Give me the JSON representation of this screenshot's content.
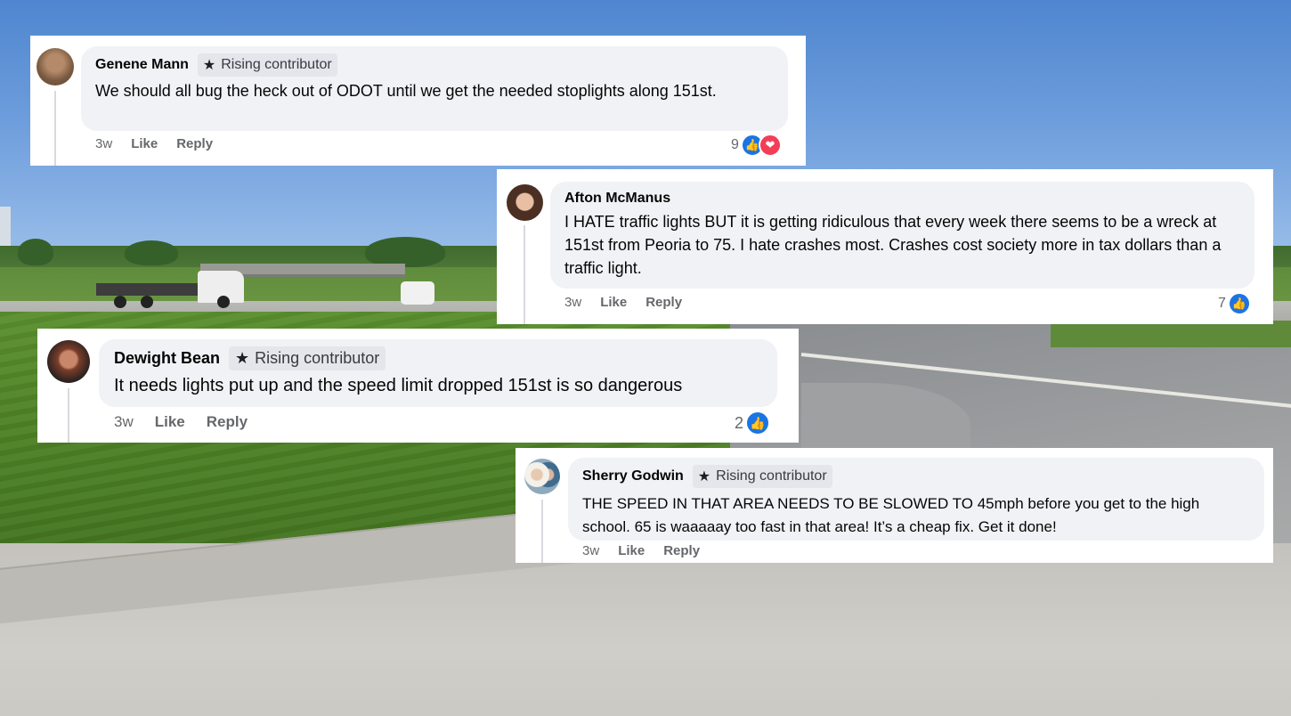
{
  "comments": [
    {
      "author": "Genene Mann",
      "badge": "Rising contributor",
      "text": "We should all bug the heck out of ODOT until we get the needed stoplights along 151st.",
      "time": "3w",
      "like_label": "Like",
      "reply_label": "Reply",
      "reaction_count": "9",
      "reactions": [
        "like-icon",
        "love-icon"
      ]
    },
    {
      "author": "Afton McManus",
      "badge": "",
      "text": "I HATE traffic lights BUT it is getting ridiculous that every week there seems to be a wreck at 151st from Peoria to 75. I hate crashes most. Crashes cost society more in tax dollars than a traffic light.",
      "time": "3w",
      "like_label": "Like",
      "reply_label": "Reply",
      "reaction_count": "7",
      "reactions": [
        "like-icon"
      ]
    },
    {
      "author": "Dewight Bean",
      "badge": "Rising contributor",
      "text": "It needs lights put up and the speed limit dropped 151st is so dangerous",
      "time": "3w",
      "like_label": "Like",
      "reply_label": "Reply",
      "reaction_count": "2",
      "reactions": [
        "like-icon"
      ]
    },
    {
      "author": "Sherry Godwin",
      "badge": "Rising contributor",
      "text": "THE SPEED IN THAT AREA NEEDS TO BE SLOWED TO 45mph before you get to the high school. 65 is waaaaay too fast in that area! It’s a cheap fix. Get it done!",
      "time": "3w",
      "like_label": "Like",
      "reply_label": "Reply",
      "reaction_count": "",
      "reactions": []
    }
  ],
  "colors": {
    "bubble": "#f0f2f5",
    "badge": "#e4e6eb",
    "meta_text": "#65676b",
    "like_blue": "#1b74e4",
    "love_red": "#f33e58"
  }
}
